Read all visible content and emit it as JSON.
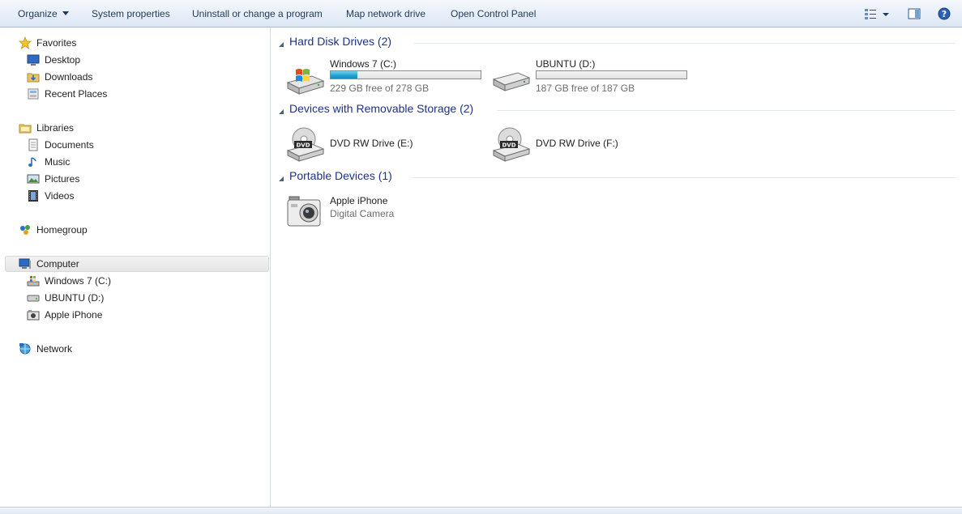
{
  "toolbar": {
    "organize": "Organize",
    "system_properties": "System properties",
    "uninstall": "Uninstall or change a program",
    "map_network": "Map network drive",
    "open_control_panel": "Open Control Panel"
  },
  "nav": {
    "favorites": "Favorites",
    "desktop": "Desktop",
    "downloads": "Downloads",
    "recent_places": "Recent Places",
    "libraries": "Libraries",
    "documents": "Documents",
    "music": "Music",
    "pictures": "Pictures",
    "videos": "Videos",
    "homegroup": "Homegroup",
    "computer": "Computer",
    "windows7": "Windows 7 (C:)",
    "ubuntu": "UBUNTU (D:)",
    "iphone": "Apple iPhone",
    "network": "Network"
  },
  "groups": {
    "hdd": "Hard Disk Drives (2)",
    "removable": "Devices with Removable Storage (2)",
    "portable": "Portable Devices (1)"
  },
  "drives": [
    {
      "name": "Windows 7 (C:)",
      "free": "229 GB free of 278 GB",
      "used_fraction": 0.176
    },
    {
      "name": "UBUNTU (D:)",
      "free": "187 GB free of 187 GB",
      "used_fraction": 0.0
    }
  ],
  "removable": [
    {
      "name": "DVD RW Drive (E:)"
    },
    {
      "name": "DVD RW Drive (F:)"
    }
  ],
  "portable": [
    {
      "name": "Apple iPhone",
      "type": "Digital Camera"
    }
  ],
  "dvd_label": "DVD",
  "colors": {
    "accent": "#1e3287",
    "bar_fill": "#1f9fd0"
  }
}
